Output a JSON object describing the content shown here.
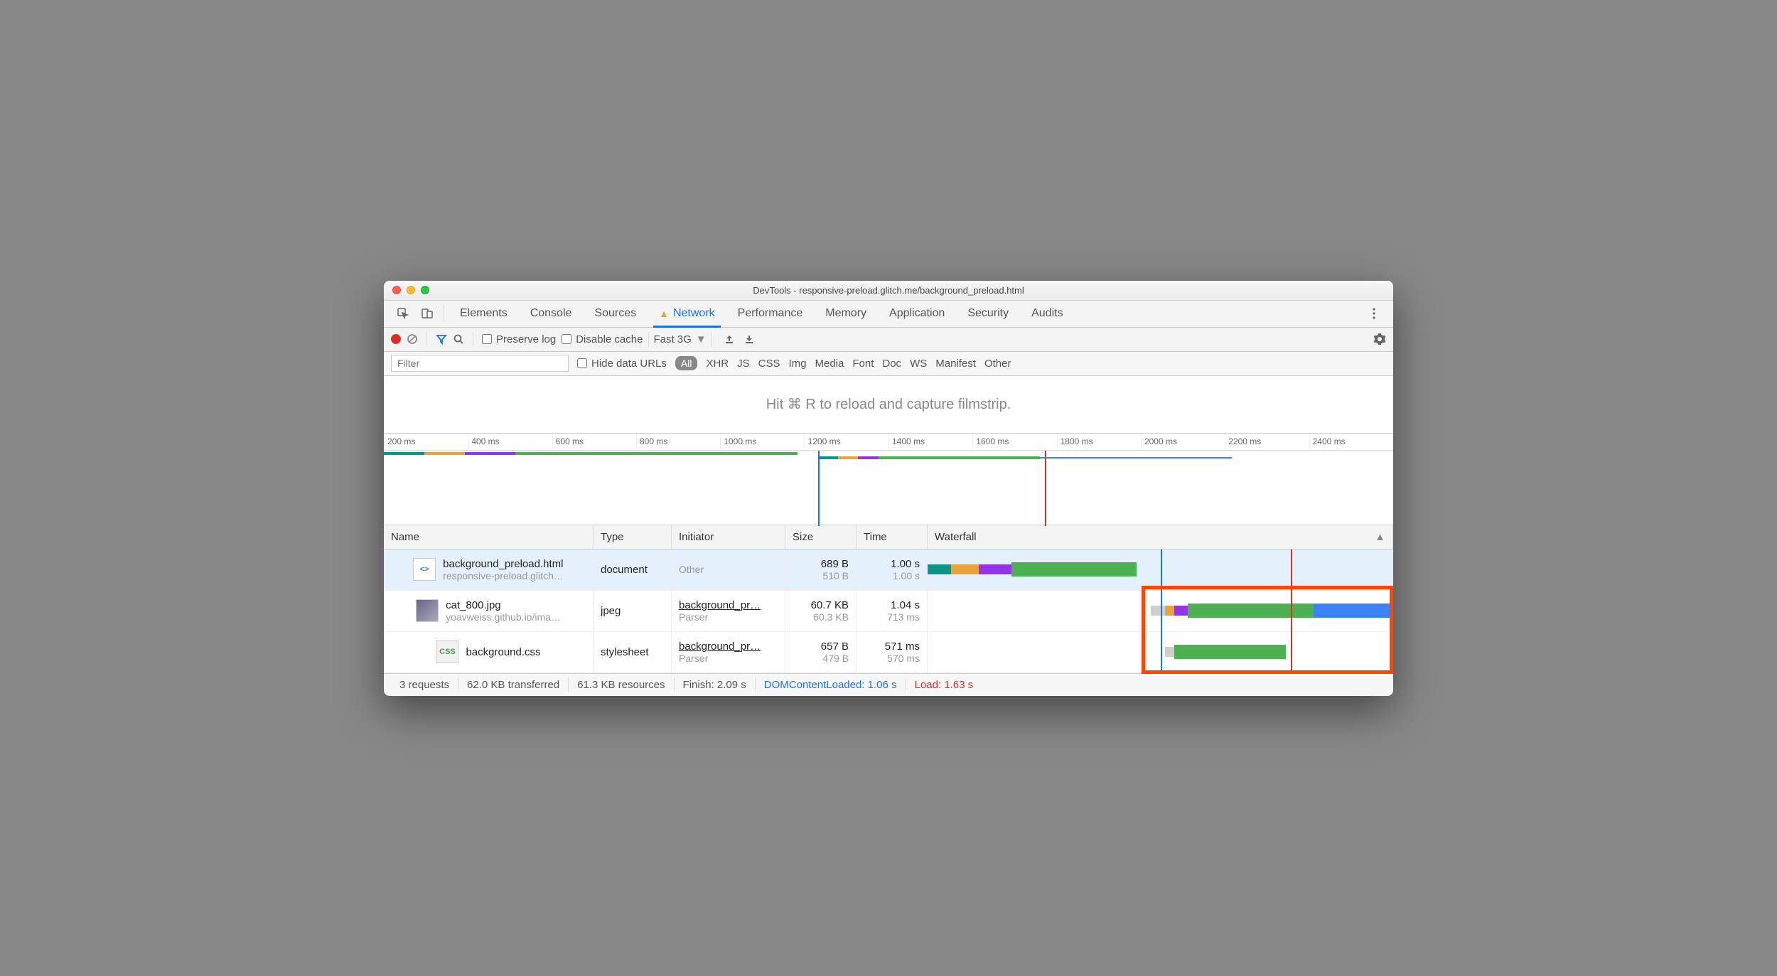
{
  "window": {
    "title": "DevTools - responsive-preload.glitch.me/background_preload.html"
  },
  "tabs": [
    "Elements",
    "Console",
    "Sources",
    "Network",
    "Performance",
    "Memory",
    "Application",
    "Security",
    "Audits"
  ],
  "active_tab": "Network",
  "toolbar": {
    "preserve_log": "Preserve log",
    "disable_cache": "Disable cache",
    "throttle": "Fast 3G"
  },
  "filterbar": {
    "placeholder": "Filter",
    "hide_data_urls": "Hide data URLs",
    "all": "All",
    "types": [
      "XHR",
      "JS",
      "CSS",
      "Img",
      "Media",
      "Font",
      "Doc",
      "WS",
      "Manifest",
      "Other"
    ]
  },
  "filmstrip_hint": "Hit ⌘ R to reload and capture filmstrip.",
  "ruler": [
    "200 ms",
    "400 ms",
    "600 ms",
    "800 ms",
    "1000 ms",
    "1200 ms",
    "1400 ms",
    "1600 ms",
    "1800 ms",
    "2000 ms",
    "2200 ms",
    "2400 ms"
  ],
  "columns": {
    "name": "Name",
    "type": "Type",
    "initiator": "Initiator",
    "size": "Size",
    "time": "Time",
    "waterfall": "Waterfall"
  },
  "requests": [
    {
      "name": "background_preload.html",
      "name_sub": "responsive-preload.glitch…",
      "icon": "html",
      "type": "document",
      "initiator": "Other",
      "initiator_sub": "",
      "size": "689 B",
      "size_sub": "510 B",
      "time": "1.00 s",
      "time_sub": "1.00 s",
      "selected": true
    },
    {
      "name": "cat_800.jpg",
      "name_sub": "yoavweiss.github.io/ima…",
      "icon": "img",
      "type": "jpeg",
      "initiator": "background_pr…",
      "initiator_sub": "Parser",
      "size": "60.7 KB",
      "size_sub": "60.3 KB",
      "time": "1.04 s",
      "time_sub": "713 ms",
      "selected": false
    },
    {
      "name": "background.css",
      "name_sub": "",
      "icon": "css",
      "type": "stylesheet",
      "initiator": "background_pr…",
      "initiator_sub": "Parser",
      "size": "657 B",
      "size_sub": "479 B",
      "time": "571 ms",
      "time_sub": "570 ms",
      "selected": false
    }
  ],
  "status": {
    "requests": "3 requests",
    "transferred": "62.0 KB transferred",
    "resources": "61.3 KB resources",
    "finish": "Finish: 2.09 s",
    "dcl": "DOMContentLoaded: 1.06 s",
    "load": "Load: 1.63 s"
  },
  "colors": {
    "teal": "#0d9488",
    "orange": "#e8a33d",
    "purple": "#9333ea",
    "green": "#4caf50",
    "blue": "#3b82f6",
    "grey": "#cfcfcf"
  }
}
